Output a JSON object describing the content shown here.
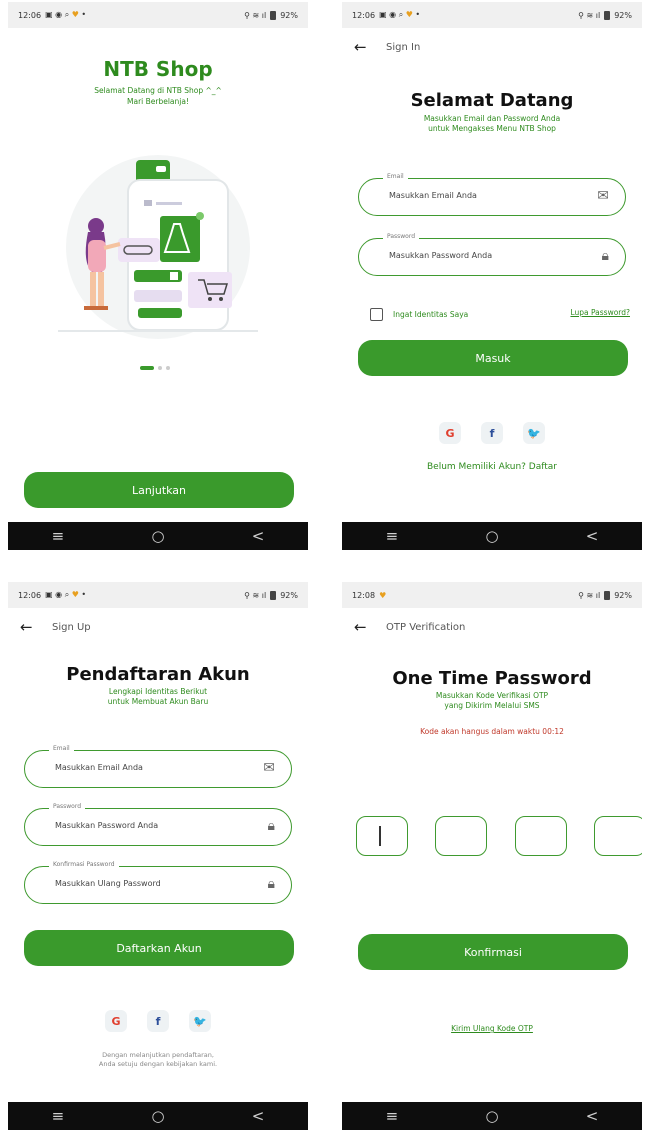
{
  "status": {
    "time_a": "12:06",
    "time_b": "12:08",
    "battery": "92%"
  },
  "nav": {
    "menu": "≡",
    "home": "○",
    "back": "<"
  },
  "welcome": {
    "title": "NTB Shop",
    "subtitle_line1": "Selamat Datang di NTB Shop ^_^",
    "subtitle_line2": "Mari Berbelanja!",
    "button": "Lanjutkan"
  },
  "signin": {
    "topbar_title": "Sign In",
    "title": "Selamat Datang",
    "sub_line1": "Masukkan Email dan Password Anda",
    "sub_line2": "untuk Mengakses Menu NTB Shop",
    "email_label": "Email",
    "email_placeholder": "Masukkan Email Anda",
    "password_label": "Password",
    "password_placeholder": "Masukkan Password Anda",
    "remember": "Ingat Identitas Saya",
    "forgot": "Lupa Password?",
    "button": "Masuk",
    "register": "Belum Memiliki Akun? Daftar"
  },
  "signup": {
    "topbar_title": "Sign Up",
    "title": "Pendaftaran Akun",
    "sub_line1": "Lengkapi Identitas Berikut",
    "sub_line2": "untuk Membuat Akun Baru",
    "email_label": "Email",
    "email_placeholder": "Masukkan Email Anda",
    "password_label": "Password",
    "password_placeholder": "Masukkan Password Anda",
    "confirm_label": "Konfirmasi Password",
    "confirm_placeholder": "Masukkan Ulang Password",
    "button": "Daftarkan Akun",
    "terms_line1": "Dengan melanjutkan pendaftaran,",
    "terms_line2": "Anda setuju dengan kebijakan kami."
  },
  "otp": {
    "topbar_title": "OTP Verification",
    "title": "One Time Password",
    "sub_line1": "Masukkan Kode Verifikasi OTP",
    "sub_line2": "yang Dikirim Melalui SMS",
    "timer": "Kode akan hangus dalam waktu 00:12",
    "button": "Konfirmasi",
    "resend": "Kirim Ulang Kode OTP"
  },
  "social": {
    "google": "G",
    "facebook": "f",
    "twitter": "🐦"
  },
  "colors": {
    "brand_green": "#3a9a2c",
    "accent_red": "#c0392b"
  }
}
